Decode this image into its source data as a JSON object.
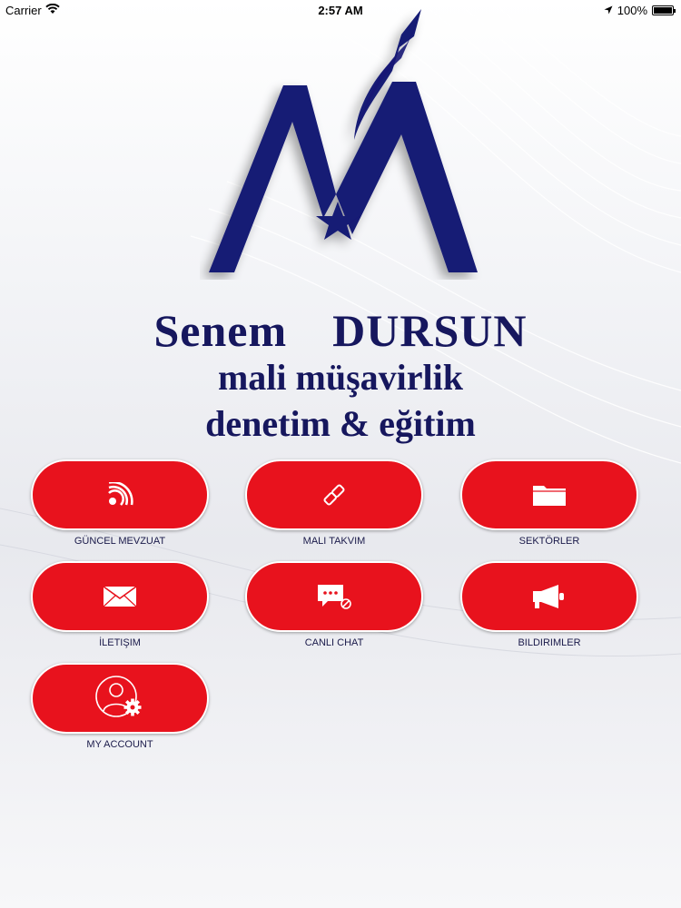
{
  "status_bar": {
    "carrier": "Carrier",
    "time": "2:57 AM",
    "battery": "100%"
  },
  "brand": {
    "name_first": "Senem",
    "name_last": "DURSUN",
    "line2": "mali müşavirlik",
    "line3": "denetim & eğitim",
    "color": "#16175e"
  },
  "menu": {
    "accent_color": "#e8121d",
    "items": [
      {
        "label": "GÜNCEL MEVZUAT",
        "icon": "rss-icon"
      },
      {
        "label": "MALI TAKVIM",
        "icon": "link-icon"
      },
      {
        "label": "SEKTÖRLER",
        "icon": "folder-icon"
      },
      {
        "label": "İLETIŞIM",
        "icon": "envelope-icon"
      },
      {
        "label": "CANLI CHAT",
        "icon": "chat-icon"
      },
      {
        "label": "BILDIRIMLER",
        "icon": "megaphone-icon"
      },
      {
        "label": "MY ACCOUNT",
        "icon": "user-settings-icon"
      }
    ]
  }
}
